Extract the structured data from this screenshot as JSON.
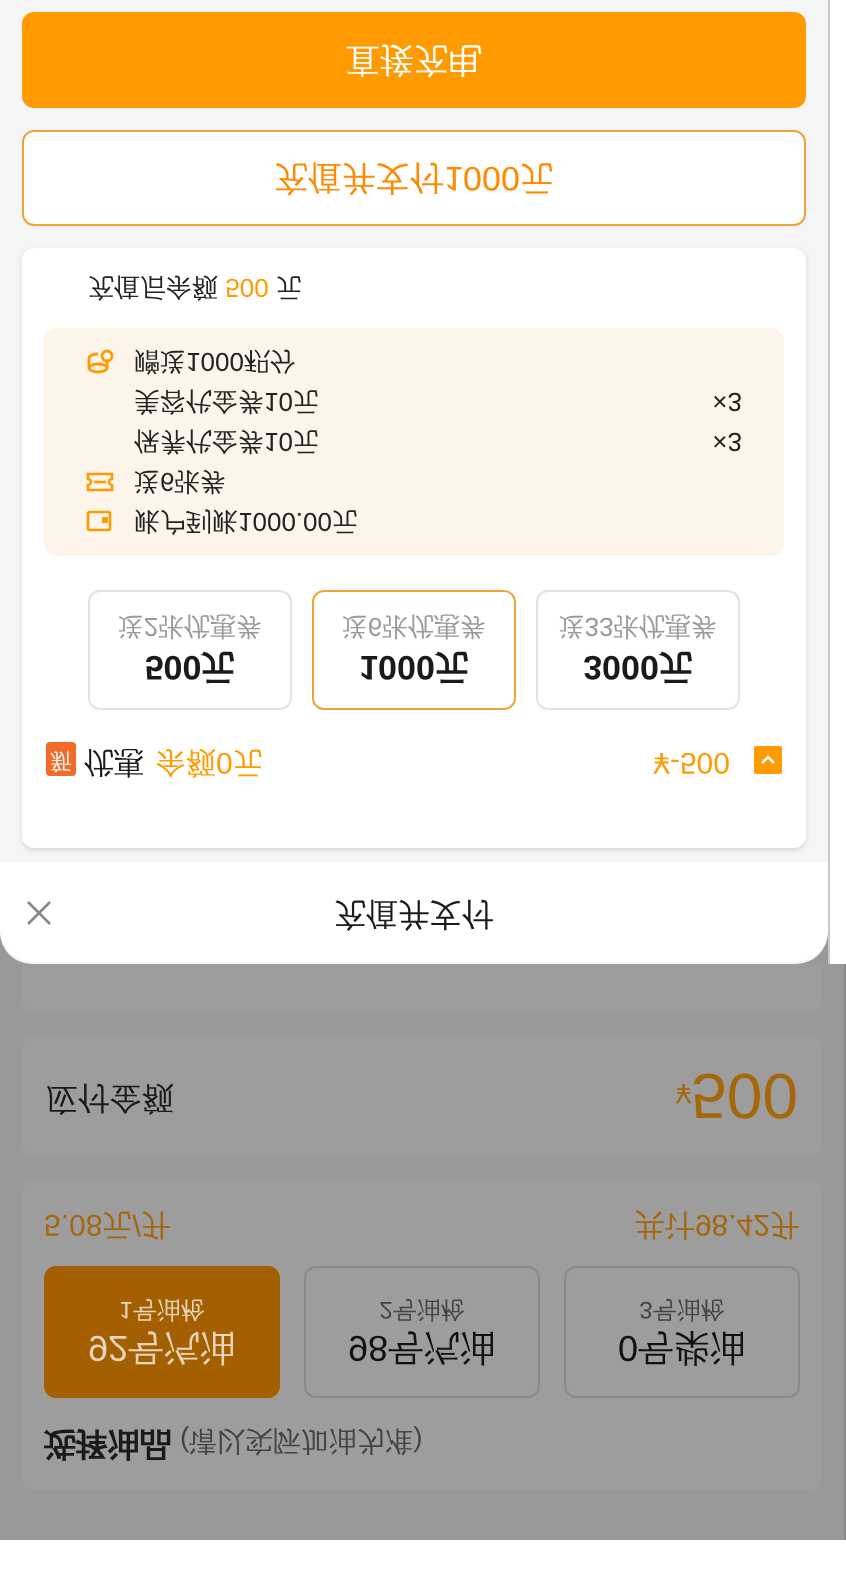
{
  "sheet": {
    "primary_button": "直接充电",
    "secondary_button": "充值并支付1000元",
    "balance_prefix": "充值后余额",
    "balance_amount": "500",
    "balance_suffix": "元",
    "benefits": [
      {
        "kind": "points",
        "text": "赠送1000积分"
      },
      {
        "kind": "plain",
        "text": "美容代金券10元",
        "count": "×3"
      },
      {
        "kind": "plain",
        "text": "保养代金券10元",
        "count": "×3"
      },
      {
        "kind": "coupon",
        "text": "送6张券"
      },
      {
        "kind": "wallet",
        "text": "账户到账1000.00元"
      }
    ],
    "plans": [
      {
        "gift": "送2张优惠券",
        "amount": "500元",
        "selected": false
      },
      {
        "gift": "送6张优惠券",
        "amount": "1000元",
        "selected": true
      },
      {
        "gift": "送33张优惠券",
        "amount": "3000元",
        "selected": false
      }
    ],
    "summary": {
      "badge": "新",
      "label": "优惠",
      "balance": "余额0元",
      "discount": "¥-500"
    },
    "title": "充值并支付"
  },
  "background": {
    "payable": {
      "label": "应付金额",
      "currency": "¥",
      "amount": "500"
    },
    "fuel_section": {
      "price": "5.08元/升",
      "volume": "共计98.42升",
      "options": [
        {
          "nozzle": "1号油枪",
          "name": "92号汽油",
          "selected": true
        },
        {
          "nozzle": "2号油枪",
          "name": "98号汽油",
          "selected": false
        },
        {
          "nozzle": "3号油枪",
          "name": "0号柴油",
          "selected": false
        }
      ],
      "title": "选择油品",
      "hint": "(请以实际加油为准)"
    }
  }
}
